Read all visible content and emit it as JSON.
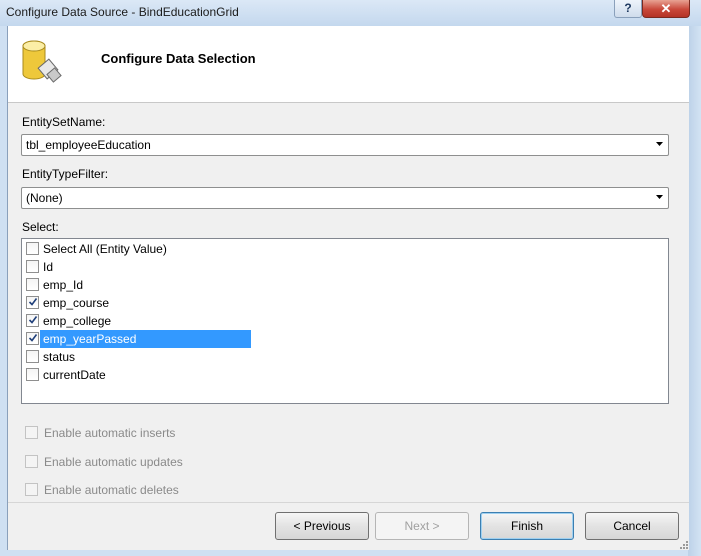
{
  "window": {
    "title": "Configure Data Source - BindEducationGrid",
    "help": "?",
    "close": "✕"
  },
  "header": {
    "title": "Configure Data Selection",
    "icon": "database-icon"
  },
  "entity_set": {
    "label": "EntitySetName:",
    "value": "tbl_employeeEducation"
  },
  "entity_type_filter": {
    "label": "EntityTypeFilter:",
    "value": "(None)"
  },
  "select": {
    "label": "Select:",
    "items": [
      {
        "label": "Select All (Entity Value)",
        "checked": false,
        "selected": false
      },
      {
        "label": "Id",
        "checked": false,
        "selected": false
      },
      {
        "label": "emp_Id",
        "checked": false,
        "selected": false
      },
      {
        "label": "emp_course",
        "checked": true,
        "selected": false
      },
      {
        "label": "emp_college",
        "checked": true,
        "selected": false
      },
      {
        "label": "emp_yearPassed",
        "checked": true,
        "selected": true
      },
      {
        "label": "status",
        "checked": false,
        "selected": false
      },
      {
        "label": "currentDate",
        "checked": false,
        "selected": false
      }
    ]
  },
  "options": {
    "inserts": "Enable automatic inserts",
    "updates": "Enable automatic updates",
    "deletes": "Enable automatic deletes"
  },
  "buttons": {
    "previous": "< Previous",
    "next": "Next >",
    "finish": "Finish",
    "cancel": "Cancel"
  },
  "colors": {
    "selection": "#3399ff",
    "accent": "#c9483a"
  }
}
